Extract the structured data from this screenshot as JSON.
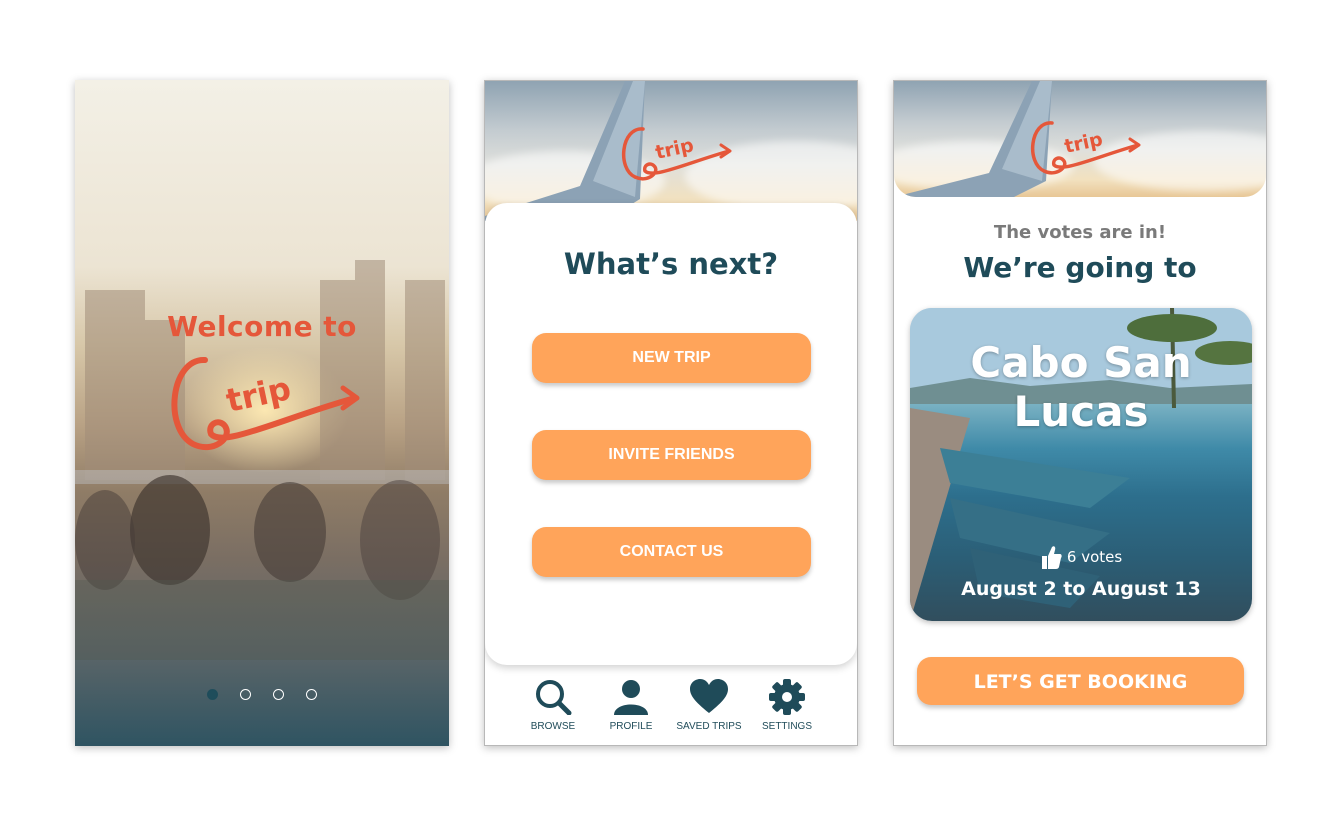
{
  "colors": {
    "accent_orange": "#ffa45a",
    "logo_red": "#e5573a",
    "navy": "#1f4b59"
  },
  "logo": {
    "text": "trip"
  },
  "screen1": {
    "welcome": "Welcome to",
    "carousel_pages": 4,
    "active_page": 1
  },
  "screen2": {
    "title": "What’s next?",
    "buttons": [
      "NEW TRIP",
      "INVITE FRIENDS",
      "CONTACT US"
    ],
    "nav": [
      {
        "label": "BROWSE",
        "icon": "search-icon"
      },
      {
        "label": "PROFILE",
        "icon": "person-icon"
      },
      {
        "label": "SAVED TRIPS",
        "icon": "heart-icon"
      },
      {
        "label": "SETTINGS",
        "icon": "gear-icon"
      }
    ]
  },
  "screen3": {
    "subtitle": "The votes are in!",
    "title": "We’re going to",
    "destination": "Cabo San Lucas",
    "votes": "6 votes",
    "dates": "August 2 to August 13",
    "cta": "LET’S GET BOOKING"
  }
}
